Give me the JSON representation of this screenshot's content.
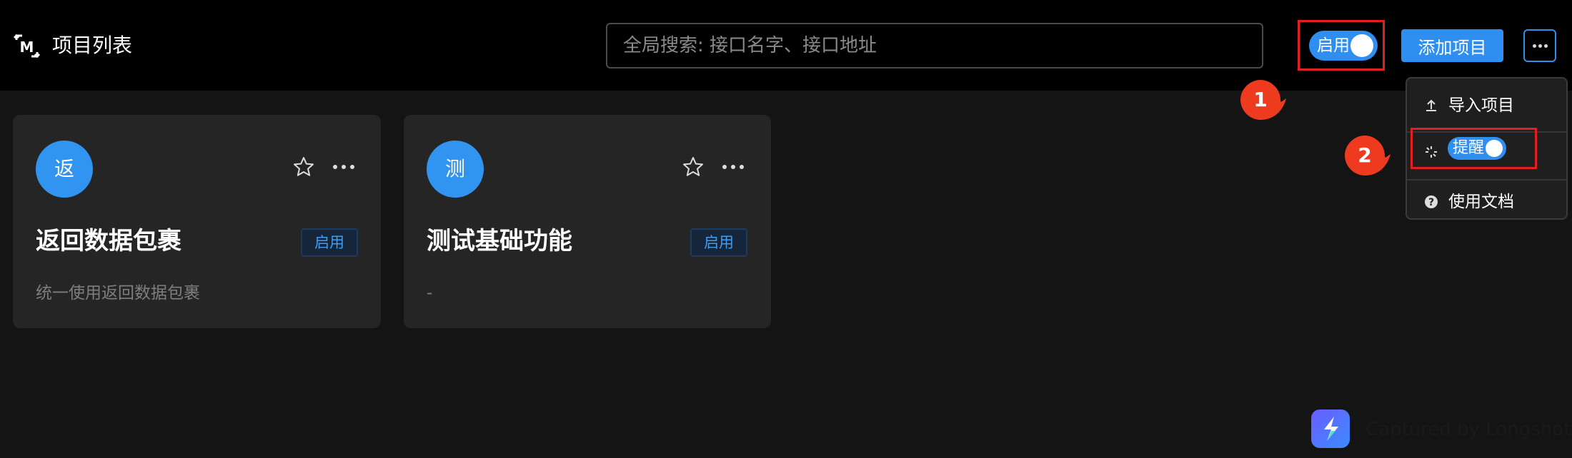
{
  "header": {
    "title": "项目列表",
    "search": {
      "placeholder": "全局搜索: 接口名字、接口地址",
      "value": ""
    },
    "enable_switch": {
      "label": "启用",
      "on": true
    },
    "add_button": "添加项目"
  },
  "more_menu": {
    "items": [
      {
        "label": "导入项目",
        "icon": "upload-icon"
      },
      {
        "label": "提醒",
        "icon": "loading-spinner-icon",
        "switch_on": true
      },
      {
        "label": "使用文档",
        "icon": "help-circle-icon"
      }
    ]
  },
  "annotations": {
    "marker1": "1",
    "marker2": "2"
  },
  "projects": [
    {
      "avatar": "返",
      "title": "返回数据包裹",
      "status": "启用",
      "description": "统一使用返回数据包裹"
    },
    {
      "avatar": "测",
      "title": "测试基础功能",
      "status": "启用",
      "description": "-"
    }
  ],
  "watermark": "Captured by Longshot",
  "colors": {
    "accent": "#2f8ff0",
    "highlight": "#e02020",
    "background": "#141414",
    "card": "#252525"
  }
}
